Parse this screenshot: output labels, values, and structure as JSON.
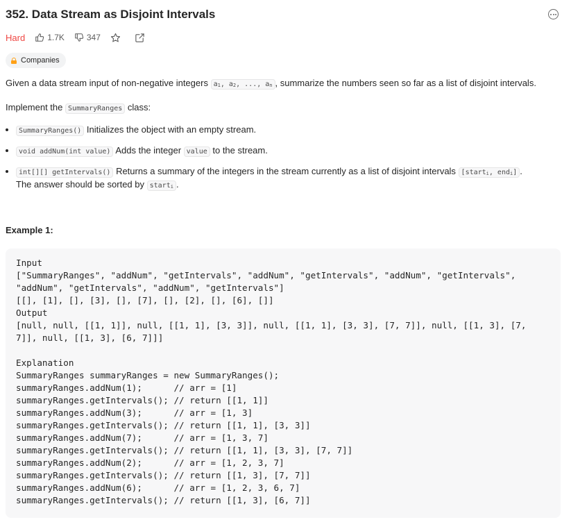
{
  "problem": {
    "title": "352. Data Stream as Disjoint Intervals",
    "difficulty": "Hard",
    "likes": "1.7K",
    "dislikes": "347",
    "companies_label": "Companies",
    "accent_colors": {
      "hard": "#ef4743",
      "lock": "#ffa116"
    },
    "icons": [
      "thumbs-up-icon",
      "thumbs-down-icon",
      "star-icon",
      "share-icon",
      "lock-icon",
      "more-icon"
    ]
  },
  "description": {
    "p1_before": "Given a data stream input of non-negative integers ",
    "seq_a1": "a",
    "seq_a1_sub": "1",
    "seq_sep1": ", a",
    "seq_a2_sub": "2",
    "seq_sep2": ", ..., a",
    "seq_an_sub": "n",
    "p1_after": ", summarize the numbers seen so far as a list of disjoint intervals.",
    "p2_before": "Implement the ",
    "p2_code": "SummaryRanges",
    "p2_after": " class:",
    "b1_code": "SummaryRanges()",
    "b1_text": " Initializes the object with an empty stream.",
    "b2_code": "void addNum(int value)",
    "b2_text": " Adds the integer ",
    "b2_code2": "value",
    "b2_text2": " to the stream.",
    "b3_code": "int[][] getIntervals()",
    "b3_text": " Returns a summary of the integers in the stream currently as a list of disjoint intervals ",
    "b3_code2_a": "[start",
    "b3_code2_sub1": "i",
    "b3_code2_b": ", end",
    "b3_code2_sub2": "i",
    "b3_code2_c": "]",
    "b3_text2": ".",
    "b3_line2_before": "The answer should be sorted by ",
    "b3_line2_code": "start",
    "b3_line2_sub": "i",
    "b3_line2_after": "."
  },
  "example": {
    "heading": "Example 1:",
    "lines": [
      "Input",
      "[\"SummaryRanges\", \"addNum\", \"getIntervals\", \"addNum\", \"getIntervals\", \"addNum\", \"getIntervals\",",
      "\"addNum\", \"getIntervals\", \"addNum\", \"getIntervals\"]",
      "[[], [1], [], [3], [], [7], [], [2], [], [6], []]",
      "Output",
      "[null, null, [[1, 1]], null, [[1, 1], [3, 3]], null, [[1, 1], [3, 3], [7, 7]], null, [[1, 3], [7,",
      "7]], null, [[1, 3], [6, 7]]]",
      "",
      "Explanation",
      "SummaryRanges summaryRanges = new SummaryRanges();",
      "summaryRanges.addNum(1);      // arr = [1]",
      "summaryRanges.getIntervals(); // return [[1, 1]]",
      "summaryRanges.addNum(3);      // arr = [1, 3]",
      "summaryRanges.getIntervals(); // return [[1, 1], [3, 3]]",
      "summaryRanges.addNum(7);      // arr = [1, 3, 7]",
      "summaryRanges.getIntervals(); // return [[1, 1], [3, 3], [7, 7]]",
      "summaryRanges.addNum(2);      // arr = [1, 2, 3, 7]",
      "summaryRanges.getIntervals(); // return [[1, 3], [7, 7]]",
      "summaryRanges.addNum(6);      // arr = [1, 2, 3, 6, 7]",
      "summaryRanges.getIntervals(); // return [[1, 3], [6, 7]]"
    ]
  }
}
